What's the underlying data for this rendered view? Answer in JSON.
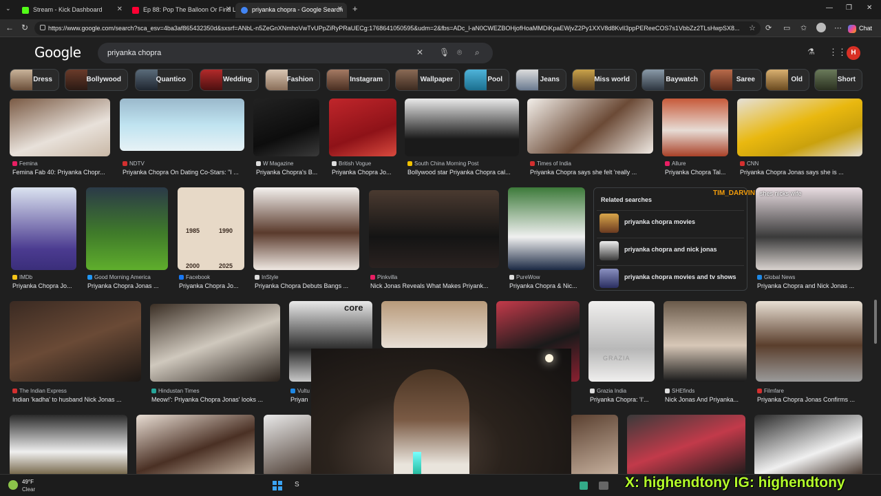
{
  "browser": {
    "tabs": [
      {
        "title": "Stream - Kick Dashboard",
        "icon": "kick-icon",
        "color": "#53fc18"
      },
      {
        "title": "Ep 88: Pop The Balloon Or Find Lo",
        "icon": "youtube-icon",
        "color": "#ff0033"
      },
      {
        "title": "priyanka chopra - Google Search",
        "icon": "google-icon",
        "color": "#4285f4"
      }
    ],
    "url": "https://www.google.com/search?sca_esv=4ba3af865432350d&sxsrf=ANbL-n5ZeGnXNmhoVwTvUPpZiRyPRaUECg:1768641050595&udm=2&fbs=ADc_l-aN0CWEZBOHjofHoaMMDiKpaEWjvZ2Py1XXV8d8KvlI3ppPEReeCOS7s1VbbZz2TLsHwpSX8...",
    "chat_label": "Chat"
  },
  "google": {
    "logo": "Google",
    "query": "priyanka chopra",
    "avatar_letter": "H"
  },
  "chips": [
    "Dress",
    "Bollywood",
    "Quantico",
    "Wedding",
    "Fashion",
    "Instagram",
    "Wallpaper",
    "Pool",
    "Jeans",
    "Miss world",
    "Baywatch",
    "Saree",
    "Old",
    "Short"
  ],
  "results": {
    "row1": [
      {
        "source": "Femina",
        "caption": "Femina Fab 40: Priyanka Chopr..."
      },
      {
        "source": "NDTV",
        "caption": "Priyanka Chopra On Dating Co-Stars: \"I ..."
      },
      {
        "source": "W Magazine",
        "caption": "Priyanka Chopra's B..."
      },
      {
        "source": "British Vogue",
        "caption": "Priyanka Chopra Jo..."
      },
      {
        "source": "South China Morning Post",
        "caption": "Bollywood star Priyanka Chopra cal..."
      },
      {
        "source": "Times of India",
        "caption": "Priyanka Chopra says she felt 'really ..."
      },
      {
        "source": "Allure",
        "caption": "Priyanka Chopra Tal..."
      },
      {
        "source": "CNN",
        "caption": "Priyanka Chopra Jonas says she is ..."
      }
    ],
    "row2": [
      {
        "source": "IMDb",
        "caption": "Priyanka Chopra Jo..."
      },
      {
        "source": "Good Morning America",
        "caption": "Priyanka Chopra Jonas ..."
      },
      {
        "source": "Facebook",
        "caption": "Priyanka Chopra Jo..."
      },
      {
        "source": "InStyle",
        "caption": "Priyanka Chopra Debuts Bangs ..."
      },
      {
        "source": "Pinkvilla",
        "caption": "Nick Jonas Reveals What Makes Priyank..."
      },
      {
        "source": "PureWow",
        "caption": "Priyanka Chopra & Nic..."
      },
      {
        "source": "Global News",
        "caption": "Priyanka Chopra and Nick Jonas ..."
      }
    ],
    "row3": [
      {
        "source": "The Indian Express",
        "caption": "Indian 'kadha' to husband Nick Jonas ..."
      },
      {
        "source": "Hindustan Times",
        "caption": "Meow!': Priyanka Chopra Jonas' looks ..."
      },
      {
        "source": "Vultu",
        "caption": "Priyan"
      },
      {
        "source": "Grazia India",
        "caption": "Priyanka Chopra: 'I'..."
      },
      {
        "source": "SHEfinds",
        "caption": "Nick Jonas And Priyanka..."
      },
      {
        "source": "Filmfare",
        "caption": "Priyanka Chopra Jonas Confirms ..."
      }
    ],
    "image_text": {
      "years": [
        "1985",
        "1990",
        "2000",
        "2025"
      ],
      "core": "core",
      "grazia": "GRAZIA"
    }
  },
  "related": {
    "title": "Related searches",
    "items": [
      "priyanka chopra movies",
      "priyanka chopra and nick jonas",
      "priyanka chopra movies and tv shows"
    ]
  },
  "overlay": {
    "streamer_tag": "TIM_DARVIN",
    "comment": "shes nicks wife",
    "social": "X: highendtony IG: highendtony"
  },
  "taskbar": {
    "temp": "49°F",
    "condition": "Clear",
    "search_letter": "S"
  }
}
